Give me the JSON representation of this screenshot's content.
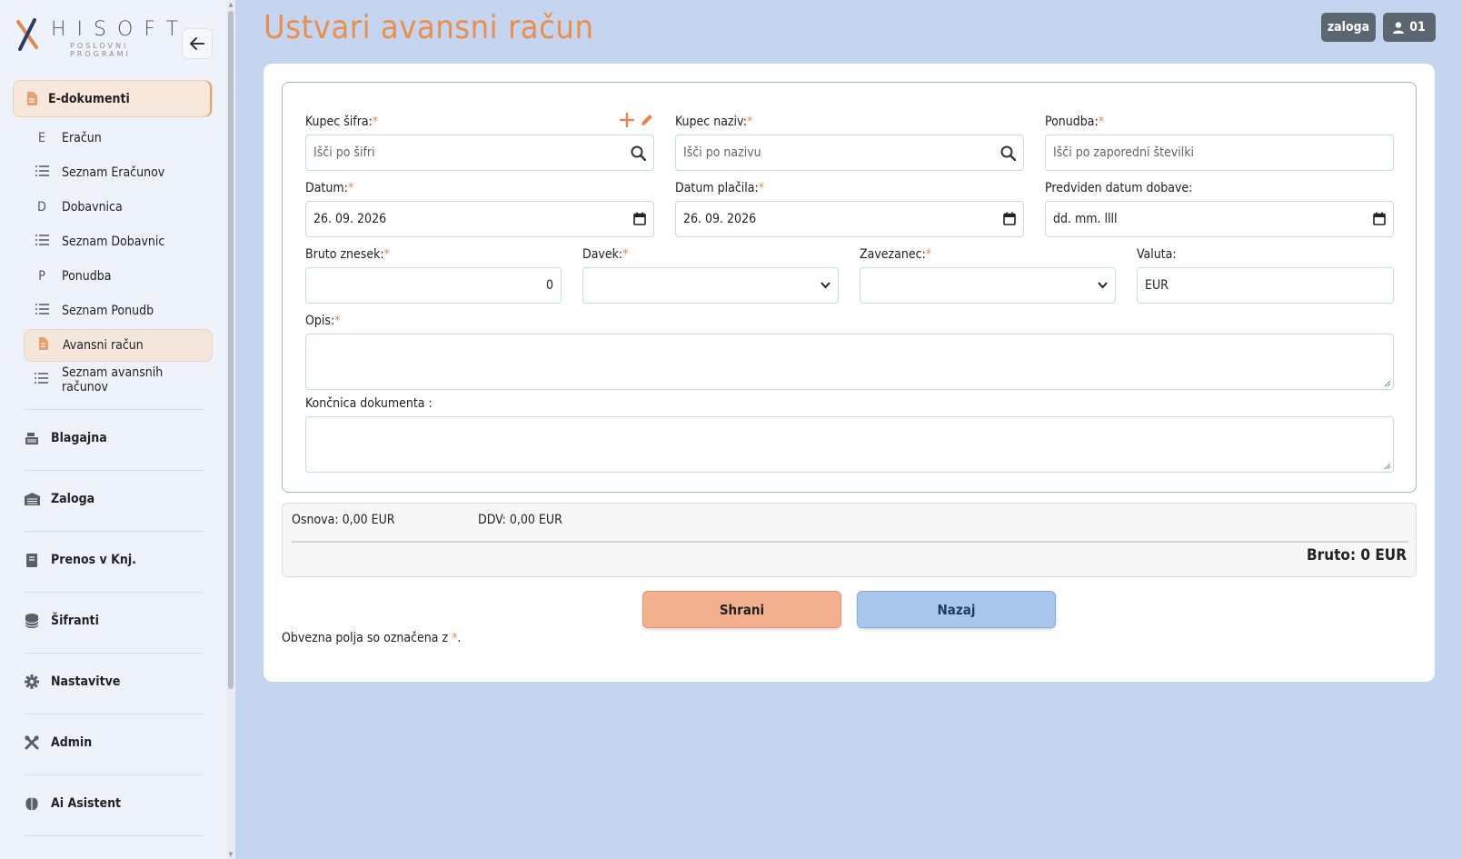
{
  "logo": {
    "brand": "HISOFT",
    "tagline": "POSLOVNI PROGRAMI"
  },
  "sidebar": {
    "section": {
      "label": "E-dokumenti",
      "icon": "file-icon"
    },
    "sub_items": [
      {
        "glyph": "E",
        "label": "Eračun"
      },
      {
        "glyph": "list",
        "label": "Seznam Eračunov"
      },
      {
        "glyph": "D",
        "label": "Dobavnica"
      },
      {
        "glyph": "list",
        "label": "Seznam Dobavnic"
      },
      {
        "glyph": "P",
        "label": "Ponudba"
      },
      {
        "glyph": "list",
        "label": "Seznam Ponudb"
      },
      {
        "glyph": "file",
        "label": "Avansni račun",
        "active": true
      },
      {
        "glyph": "list",
        "label": "Seznam avansnih računov"
      }
    ],
    "main_items": [
      {
        "label": "Blagajna",
        "icon": "cash-register-icon"
      },
      {
        "label": "Zaloga",
        "icon": "warehouse-icon"
      },
      {
        "label": "Prenos v Knj.",
        "icon": "book-icon"
      },
      {
        "label": "Šifranti",
        "icon": "database-icon"
      },
      {
        "label": "Nastavitve",
        "icon": "gear-icon"
      },
      {
        "label": "Admin",
        "icon": "tools-icon"
      },
      {
        "label": "Ai Asistent",
        "icon": "brain-icon"
      }
    ]
  },
  "header": {
    "title": "Ustvari avansni račun",
    "zaloga_label": "zaloga",
    "user_label": "01"
  },
  "form": {
    "kupec_sifra": {
      "label": "Kupec šifra:",
      "placeholder": "Išči po šifri"
    },
    "kupec_naziv": {
      "label": "Kupec naziv:",
      "placeholder": "Išči po nazivu"
    },
    "ponudba": {
      "label": "Ponudba:",
      "placeholder": "Išči po zaporedni številki"
    },
    "datum": {
      "label": "Datum:",
      "value": "26. 09. 2026"
    },
    "datum_placila": {
      "label": "Datum plačila:",
      "value": "26. 09. 2026"
    },
    "predviden": {
      "label": "Predviden datum dobave:",
      "value": "dd. mm. llll"
    },
    "bruto_znesek": {
      "label": "Bruto znesek:",
      "value": "0"
    },
    "davek": {
      "label": "Davek:",
      "value": ""
    },
    "zavezanec": {
      "label": "Zavezanec:",
      "value": ""
    },
    "valuta": {
      "label": "Valuta:",
      "value": "EUR"
    },
    "opis": {
      "label": "Opis:",
      "value": ""
    },
    "koncnica": {
      "label": "Končnica dokumenta :",
      "value": ""
    },
    "required_mark": "*"
  },
  "totals": {
    "osnova": "Osnova: 0,00 EUR",
    "ddv": "DDV: 0,00 EUR",
    "bruto": "Bruto: 0 EUR"
  },
  "actions": {
    "save": "Shrani",
    "back": "Nazaj"
  },
  "note": {
    "text": "Obvezna polja so označena z ",
    "mark": "*",
    "end": "."
  },
  "colors": {
    "accent": "#e88f4e",
    "background": "#c5d5ef",
    "save_button": "#f2b08e",
    "back_button": "#a9c6ec"
  }
}
